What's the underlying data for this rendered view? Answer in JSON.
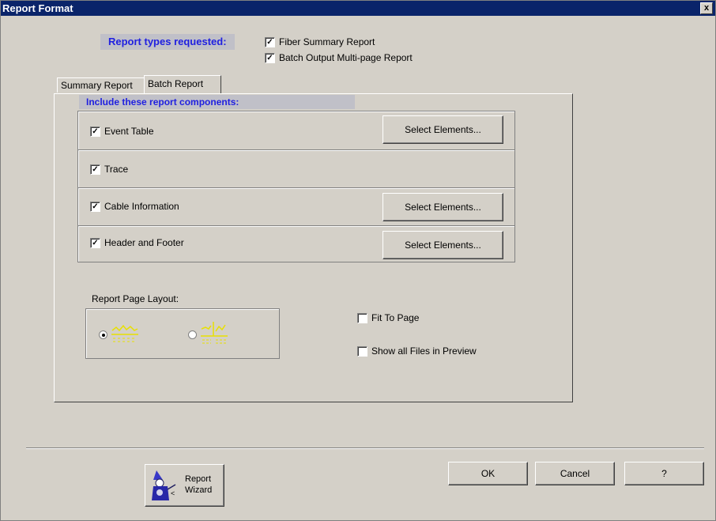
{
  "window": {
    "title": "Report Format",
    "close_label": "x"
  },
  "report_types": {
    "label": "Report types requested:",
    "options": [
      {
        "label": "Fiber Summary Report",
        "checked": true
      },
      {
        "label": "Batch Output Multi-page Report",
        "checked": true
      }
    ]
  },
  "tabs": [
    {
      "label": "Summary Report",
      "active": false
    },
    {
      "label": "Batch Report",
      "active": true
    }
  ],
  "components": {
    "label": "Include these report components:",
    "rows": [
      {
        "label": "Event Table",
        "checked": true,
        "button": "Select Elements..."
      },
      {
        "label": "Trace",
        "checked": true
      },
      {
        "label": "Cable Information",
        "checked": true,
        "button": "Select Elements..."
      },
      {
        "label": "Header and Footer",
        "checked": true,
        "button": "Select Elements..."
      }
    ]
  },
  "page_layout": {
    "label": "Report Page Layout:",
    "options": [
      {
        "icon": "single-column-layout-icon",
        "selected": true
      },
      {
        "icon": "double-column-layout-icon",
        "selected": false
      }
    ]
  },
  "options": {
    "fit_to_page": {
      "label": "Fit To Page",
      "checked": false
    },
    "show_all_files": {
      "label": "Show all Files in Preview",
      "checked": false
    }
  },
  "buttons": {
    "ok": "OK",
    "cancel": "Cancel",
    "help": "?",
    "wizard_line1": "Report",
    "wizard_line2": "Wizard"
  },
  "colors": {
    "title_bar": "#0a246a",
    "dialog_bg": "#d4d0c8",
    "label_text": "#2020e0",
    "icon_yellow": "#e8e000"
  }
}
